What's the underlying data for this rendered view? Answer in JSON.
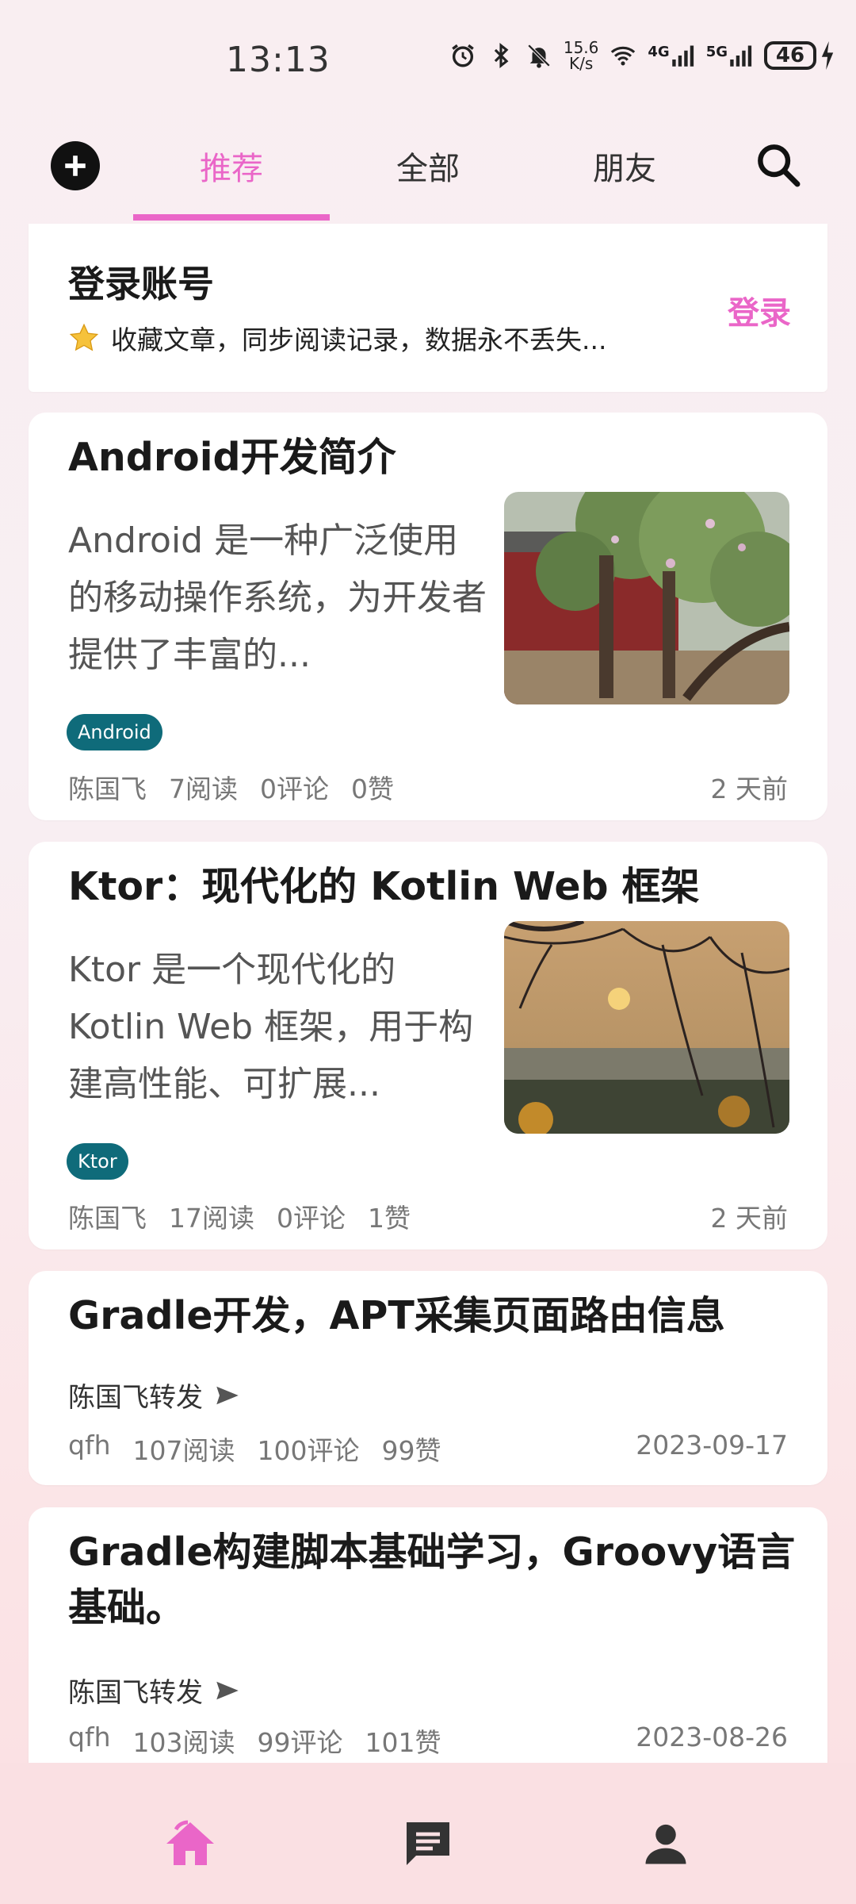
{
  "status": {
    "time": "13:13",
    "net_speed_value": "15.6",
    "net_speed_unit": "K/s",
    "signal1": "4G",
    "signal2": "5G",
    "battery": "46"
  },
  "tabs": [
    "推荐",
    "全部",
    "朋友"
  ],
  "login_card": {
    "title": "登录账号",
    "subtitle": "收藏文章，同步阅读记录，数据永不丢失...",
    "action": "登录"
  },
  "articles": [
    {
      "title": "Android开发简介",
      "summary": "Android 是一种广泛使用的移动操作系统，为开发者提供了丰富的...",
      "tag": "Android",
      "author": "陈国飞",
      "reads": "7阅读",
      "comments": "0评论",
      "likes": "0赞",
      "date": "2 天前"
    },
    {
      "title": "Ktor：现代化的 Kotlin Web 框架",
      "summary": "Ktor 是一个现代化的 Kotlin Web 框架，用于构建高性能、可扩展...",
      "tag": "Ktor",
      "author": "陈国飞",
      "reads": "17阅读",
      "comments": "0评论",
      "likes": "1赞",
      "date": "2 天前"
    },
    {
      "title": "Gradle开发，APT采集页面路由信息",
      "forward": "陈国飞转发",
      "author": "qfh",
      "reads": "107阅读",
      "comments": "100评论",
      "likes": "99赞",
      "date": "2023-09-17"
    },
    {
      "title": "Gradle构建脚本基础学习，Groovy语言基础。",
      "forward": "陈国飞转发",
      "author": "qfh",
      "reads": "103阅读",
      "comments": "99评论",
      "likes": "101赞",
      "date": "2023-08-26"
    }
  ],
  "colors": {
    "accent": "#ea66c8",
    "tag_bg": "#0f6b7a"
  },
  "icons": {
    "add": "add-circle-icon",
    "search": "search-icon",
    "home": "home-icon",
    "messages": "message-icon",
    "profile": "person-icon"
  }
}
